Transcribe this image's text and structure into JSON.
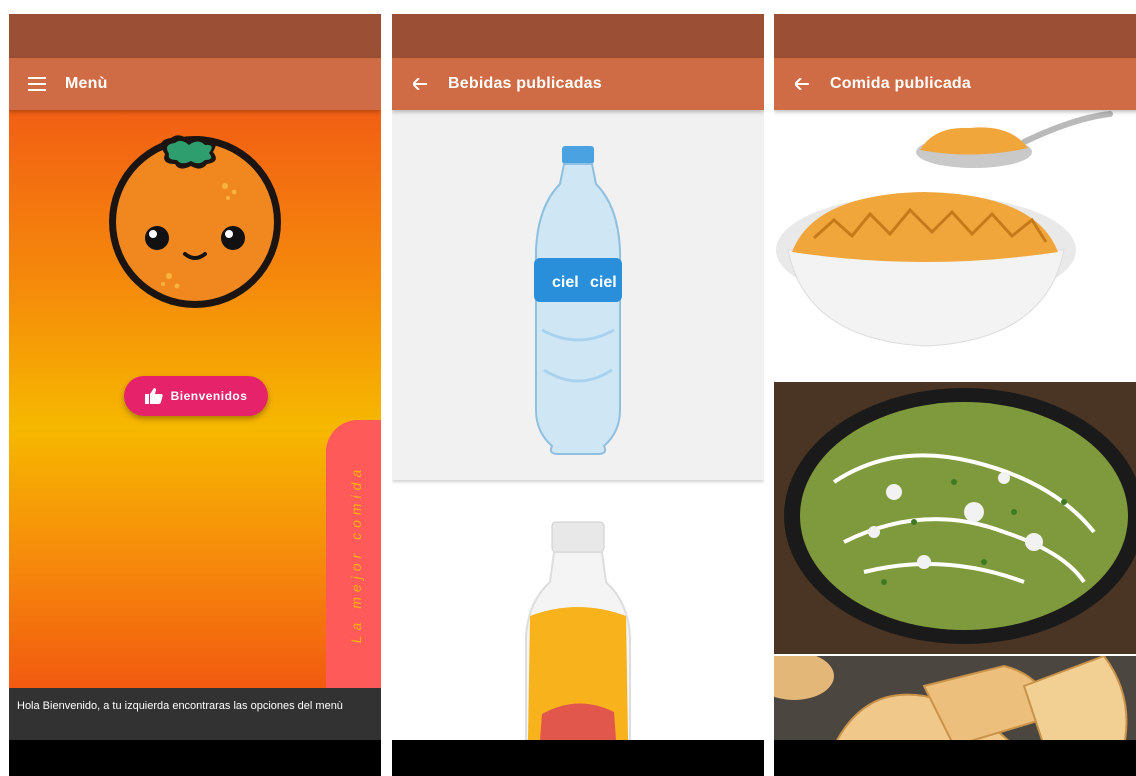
{
  "screens": {
    "menu": {
      "title": "Menù",
      "welcome_button": "Bienvenidos",
      "side_text": "La mejor comida",
      "snackbar": "Hola Bienvenido, a tu izquierda encontraras las opciones del menù"
    },
    "drinks": {
      "title": "Bebidas publicadas",
      "bottle_brand": "ciel"
    },
    "food": {
      "title": "Comida publicada"
    }
  },
  "icons": {
    "menu_nav": "hamburger-menu-icon",
    "drinks_nav": "arrow-back-icon",
    "food_nav": "arrow-back-icon",
    "welcome": "thumbs-up-icon"
  },
  "colors": {
    "status_bar": "#9b4f34",
    "app_bar": "#cf6b45",
    "welcome_button": "#e6226b",
    "side_tab": "#ff5a5a",
    "side_text": "#ffb300",
    "snackbar": "#323232"
  }
}
